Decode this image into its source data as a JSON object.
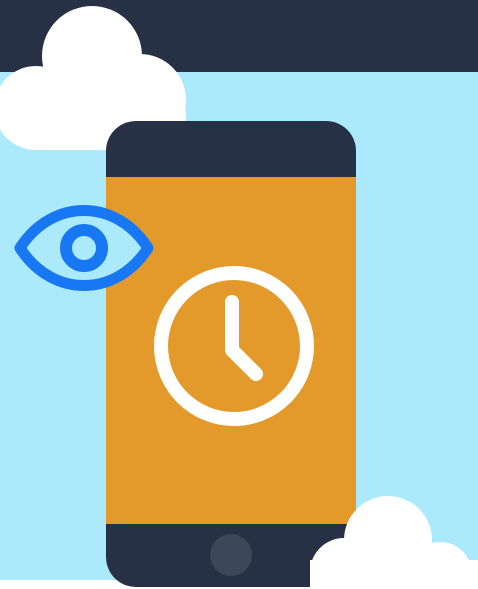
{
  "colors": {
    "sky": "#abeafd",
    "header_band": "#263145",
    "cloud": "#ffffff",
    "phone_body": "#263145",
    "phone_screen": "#e39a2b",
    "home_button": "#3c475a",
    "clock_stroke": "#ffffff",
    "eye_stroke": "#1877f2"
  },
  "icons": {
    "eye": "eye-icon",
    "clock": "clock-icon",
    "home_button": "home-button",
    "cloud": "cloud-icon"
  }
}
